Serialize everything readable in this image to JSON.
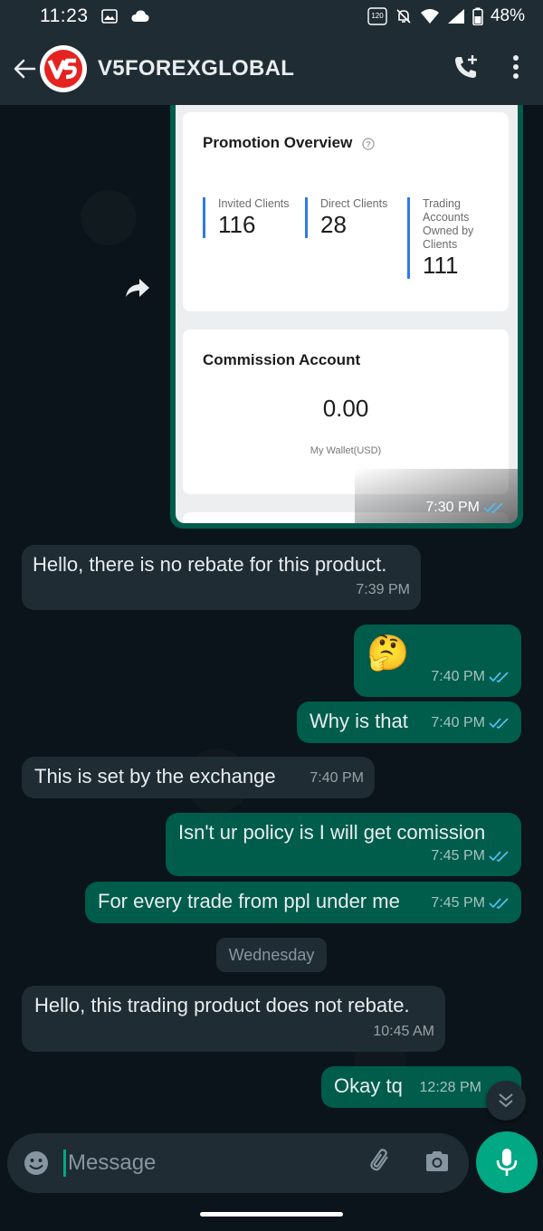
{
  "status_bar": {
    "time": "11:23",
    "battery": "48%",
    "refresh_rate": "120"
  },
  "header": {
    "contact_name": "V5FOREXGLOBAL",
    "avatar_text": "V5"
  },
  "image_message": {
    "promotion_title": "Promotion Overview",
    "stats": [
      {
        "label": "Invited Clients",
        "value": "116"
      },
      {
        "label": "Direct Clients",
        "value": "28"
      },
      {
        "label": "Trading Accounts Owned by Clients",
        "value": "111"
      }
    ],
    "commission_title": "Commission Account",
    "wallet_amount": "0.00",
    "wallet_label": "My Wallet(USD)",
    "time": "7:30 PM"
  },
  "messages": [
    {
      "direction": "in",
      "text": "Hello, there is no rebate for this product.",
      "time": "7:39 PM"
    },
    {
      "direction": "out",
      "text": "🤔",
      "time": "7:40 PM"
    },
    {
      "direction": "out",
      "text": "Why is that",
      "time": "7:40 PM"
    },
    {
      "direction": "in",
      "text": "This is set by the exchange",
      "time": "7:40 PM"
    },
    {
      "direction": "out",
      "text": "Isn't ur policy is I will get comission",
      "time": "7:45 PM"
    },
    {
      "direction": "out",
      "text": "For every trade from ppl under me",
      "time": "7:45 PM"
    },
    {
      "direction": "in",
      "text": "Hello, this trading product does not rebate.",
      "time": "10:45 AM"
    },
    {
      "direction": "out",
      "text": "Okay tq",
      "time": "12:28 PM"
    }
  ],
  "day_separator": "Wednesday",
  "composer": {
    "placeholder": "Message"
  },
  "colors": {
    "header_bg": "#1f2c34",
    "chat_bg": "#0b141a",
    "incoming_bubble": "#1f2c34",
    "outgoing_bubble": "#005c4b",
    "accent": "#00a884",
    "read_ticks": "#53bdeb"
  },
  "icons": [
    "back-arrow-icon",
    "add-call-icon",
    "more-vertical-icon",
    "forward-icon",
    "info-icon",
    "double-check-icon",
    "emoji-icon",
    "attach-icon",
    "camera-icon",
    "mic-icon",
    "chevron-down-icon"
  ]
}
